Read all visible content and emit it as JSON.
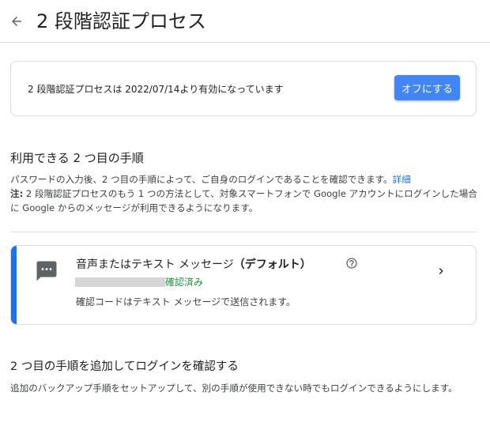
{
  "header": {
    "title": "2 段階認証プロセス",
    "back_icon": "arrow-back-icon"
  },
  "status": {
    "text": "2 段階認証プロセスは 2022/07/14より有効になっています",
    "button_label": "オフにする",
    "button_color": "#4285f4"
  },
  "second_steps": {
    "title": "利用できる 2 つ目の手順",
    "description": "パスワードの入力後、2 つ目の手順によって、ご自身のログインであることを確認できます。",
    "details_link": "詳細",
    "note_label": "注:",
    "note_text": " 2 段階認証プロセスのもう 1 つの方法として、対象スマートフォンで Google アカウントにログインした場合に Google からのメッセージが利用できるようになります。"
  },
  "method": {
    "title": "音声またはテキスト メッセージ",
    "default_label": "（デフォルト）",
    "verified_label": "確認済み",
    "description": "確認コードはテキスト メッセージで送信されます。",
    "icon": "sms-icon",
    "accent_color": "#1a73e8",
    "verified_color": "#1e8e3e"
  },
  "add_step": {
    "title": "2 つ目の手順を追加してログインを確認する",
    "description": "追加のバックアップ手順をセットアップして、別の手順が使用できない時でもログインできるようにします。"
  }
}
